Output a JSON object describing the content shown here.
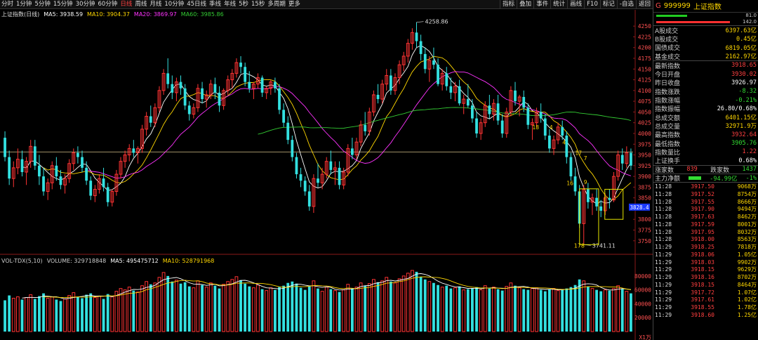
{
  "toolbar": {
    "periods": [
      "分时",
      "1分钟",
      "5分钟",
      "15分钟",
      "30分钟",
      "60分钟",
      "日线",
      "周线",
      "月线",
      "10分钟",
      "45日线",
      "季线",
      "年线",
      "5秒",
      "15秒",
      "多周期",
      "更多"
    ],
    "active_period": "日线",
    "buttons": [
      "指标",
      "叠加",
      "事件",
      "统计",
      "画线",
      "F10",
      "标记",
      "-自选",
      "返回"
    ]
  },
  "chart_title": "上证指数(日线)",
  "ma_legend": [
    {
      "label": "MA5: 3938.59",
      "color": "#ffffff"
    },
    {
      "label": "MA10: 3904.37",
      "color": "#ffd700"
    },
    {
      "label": "MA20: 3869.97",
      "color": "#ff33ff"
    },
    {
      "label": "MA60: 3985.86",
      "color": "#33cc33"
    }
  ],
  "vol_legend": [
    {
      "label": "VOL-TDX(5,10)",
      "color": "#cccccc"
    },
    {
      "label": "VOLUME: 329718848",
      "color": "#cccccc"
    },
    {
      "label": "MA5: 495475712",
      "color": "#ffffff"
    },
    {
      "label": "MA10: 528791968",
      "color": "#ffd700"
    }
  ],
  "price_axis": [
    "4250",
    "4225",
    "4200",
    "4175",
    "4150",
    "4125",
    "4100",
    "4075",
    "4050",
    "4025",
    "4000",
    "3975",
    "3950",
    "3925",
    "3900",
    "3875",
    "3850",
    "3828.4",
    "3800",
    "3775",
    "3750"
  ],
  "current_price_tag": "3828.4",
  "volume_axis": [
    "80000",
    "60000",
    "40000",
    "20000",
    "X1万"
  ],
  "annotations": {
    "high": "4258.86",
    "low": "3741.11",
    "low_left": "178",
    "marks": [
      "18",
      "4",
      "4",
      "17",
      "7",
      "16",
      "9"
    ]
  },
  "chart_data": {
    "type": "candlestick",
    "price_range": [
      3730,
      4265
    ],
    "reference_line": 3957,
    "volume_range": [
      0,
      95000
    ],
    "ohlc": [
      [
        3990,
        4005,
        3935,
        3945
      ],
      [
        3945,
        3960,
        3880,
        3895
      ],
      [
        3895,
        3935,
        3875,
        3920
      ],
      [
        3920,
        3965,
        3905,
        3940
      ],
      [
        3940,
        3960,
        3900,
        3910
      ],
      [
        3910,
        3945,
        3880,
        3935
      ],
      [
        3935,
        3985,
        3920,
        3970
      ],
      [
        3970,
        3985,
        3915,
        3925
      ],
      [
        3925,
        3950,
        3880,
        3900
      ],
      [
        3900,
        3920,
        3855,
        3865
      ],
      [
        3865,
        3895,
        3845,
        3885
      ],
      [
        3885,
        3935,
        3870,
        3925
      ],
      [
        3925,
        3945,
        3890,
        3900
      ],
      [
        3900,
        3915,
        3870,
        3880
      ],
      [
        3880,
        3905,
        3860,
        3895
      ],
      [
        3895,
        3940,
        3885,
        3930
      ],
      [
        3930,
        3965,
        3915,
        3955
      ],
      [
        3955,
        3970,
        3930,
        3945
      ],
      [
        3945,
        3960,
        3910,
        3920
      ],
      [
        3920,
        3935,
        3880,
        3890
      ],
      [
        3890,
        3900,
        3845,
        3855
      ],
      [
        3855,
        3880,
        3840,
        3870
      ],
      [
        3870,
        3905,
        3860,
        3895
      ],
      [
        3895,
        3920,
        3865,
        3875
      ],
      [
        3875,
        3885,
        3830,
        3840
      ],
      [
        3840,
        3870,
        3830,
        3865
      ],
      [
        3865,
        3915,
        3855,
        3905
      ],
      [
        3905,
        3945,
        3895,
        3935
      ],
      [
        3935,
        3960,
        3920,
        3950
      ],
      [
        3950,
        3975,
        3935,
        3965
      ],
      [
        3965,
        3985,
        3945,
        3955
      ],
      [
        3955,
        3970,
        3930,
        3965
      ],
      [
        3965,
        4020,
        3955,
        4010
      ],
      [
        4010,
        4050,
        3995,
        4040
      ],
      [
        4040,
        4065,
        4015,
        4025
      ],
      [
        4025,
        4070,
        4015,
        4060
      ],
      [
        4060,
        4110,
        4050,
        4100
      ],
      [
        4100,
        4150,
        4090,
        4140
      ],
      [
        4140,
        4175,
        4105,
        4115
      ],
      [
        4115,
        4135,
        4080,
        4095
      ],
      [
        4095,
        4130,
        4075,
        4120
      ],
      [
        4120,
        4135,
        4090,
        4105
      ],
      [
        4105,
        4115,
        4055,
        4065
      ],
      [
        4065,
        4075,
        4030,
        4045
      ],
      [
        4045,
        4070,
        4035,
        4060
      ],
      [
        4060,
        4115,
        4050,
        4105
      ],
      [
        4105,
        4120,
        4070,
        4080
      ],
      [
        4080,
        4100,
        4060,
        4090
      ],
      [
        4090,
        4125,
        4080,
        4115
      ],
      [
        4115,
        4130,
        4080,
        4095
      ],
      [
        4095,
        4110,
        4050,
        4065
      ],
      [
        4065,
        4105,
        4055,
        4100
      ],
      [
        4100,
        4135,
        4090,
        4125
      ],
      [
        4125,
        4150,
        4105,
        4140
      ],
      [
        4140,
        4175,
        4130,
        4165
      ],
      [
        4165,
        4180,
        4140,
        4155
      ],
      [
        4155,
        4165,
        4110,
        4120
      ],
      [
        4120,
        4145,
        4095,
        4105
      ],
      [
        4105,
        4120,
        4080,
        4115
      ],
      [
        4115,
        4140,
        4105,
        4130
      ],
      [
        4130,
        4135,
        4085,
        4095
      ],
      [
        4095,
        4110,
        4080,
        4105
      ],
      [
        4105,
        4125,
        4090,
        4120
      ],
      [
        4120,
        4130,
        4095,
        4105
      ],
      [
        4105,
        4115,
        4045,
        4055
      ],
      [
        4055,
        4070,
        4015,
        4025
      ],
      [
        4025,
        4040,
        3975,
        3985
      ],
      [
        3985,
        3995,
        3935,
        3945
      ],
      [
        3945,
        3955,
        3895,
        3905
      ],
      [
        3905,
        3920,
        3875,
        3890
      ],
      [
        3890,
        3900,
        3855,
        3865
      ],
      [
        3865,
        3880,
        3820,
        3830
      ],
      [
        3830,
        3905,
        3815,
        3895
      ],
      [
        3895,
        3930,
        3875,
        3885
      ],
      [
        3885,
        3920,
        3870,
        3905
      ],
      [
        3905,
        3945,
        3895,
        3935
      ],
      [
        3935,
        3960,
        3905,
        3915
      ],
      [
        3915,
        3935,
        3880,
        3920
      ],
      [
        3920,
        3935,
        3870,
        3880
      ],
      [
        3880,
        3920,
        3870,
        3910
      ],
      [
        3910,
        3975,
        3900,
        3965
      ],
      [
        3965,
        3990,
        3940,
        3950
      ],
      [
        3950,
        3990,
        3940,
        3980
      ],
      [
        3980,
        4030,
        3970,
        4020
      ],
      [
        4020,
        4050,
        3995,
        4005
      ],
      [
        4005,
        4060,
        3995,
        4050
      ],
      [
        4050,
        4100,
        4040,
        4090
      ],
      [
        4090,
        4115,
        4070,
        4080
      ],
      [
        4080,
        4125,
        4070,
        4115
      ],
      [
        4115,
        4150,
        4100,
        4135
      ],
      [
        4135,
        4150,
        4090,
        4100
      ],
      [
        4100,
        4140,
        4090,
        4130
      ],
      [
        4130,
        4170,
        4115,
        4160
      ],
      [
        4160,
        4190,
        4145,
        4180
      ],
      [
        4180,
        4220,
        4165,
        4210
      ],
      [
        4210,
        4245,
        4195,
        4235
      ],
      [
        4235,
        4259,
        4200,
        4215
      ],
      [
        4215,
        4230,
        4170,
        4185
      ],
      [
        4185,
        4200,
        4140,
        4150
      ],
      [
        4150,
        4180,
        4120,
        4170
      ],
      [
        4170,
        4200,
        4150,
        4160
      ],
      [
        4160,
        4175,
        4110,
        4115
      ],
      [
        4115,
        4150,
        4100,
        4140
      ],
      [
        4140,
        4155,
        4100,
        4110
      ],
      [
        4110,
        4130,
        4080,
        4095
      ],
      [
        4095,
        4120,
        4075,
        4110
      ],
      [
        4110,
        4125,
        4065,
        4070
      ],
      [
        4070,
        4090,
        4045,
        4080
      ],
      [
        4080,
        4115,
        4060,
        4065
      ],
      [
        4065,
        4080,
        4025,
        4035
      ],
      [
        4035,
        4050,
        3990,
        4000
      ],
      [
        4000,
        4035,
        3985,
        4025
      ],
      [
        4025,
        4075,
        4015,
        4065
      ],
      [
        4065,
        4090,
        4035,
        4045
      ],
      [
        4045,
        4080,
        4030,
        4070
      ],
      [
        4070,
        4090,
        4020,
        4030
      ],
      [
        4030,
        4045,
        3990,
        4000
      ],
      [
        4000,
        4060,
        3990,
        4050
      ],
      [
        4050,
        4110,
        4040,
        4100
      ],
      [
        4100,
        4120,
        4065,
        4075
      ],
      [
        4075,
        4090,
        4040,
        4085
      ],
      [
        4085,
        4100,
        4050,
        4060
      ],
      [
        4060,
        4070,
        4010,
        4020
      ],
      [
        4020,
        4035,
        3985,
        4025
      ],
      [
        4025,
        4060,
        4015,
        4050
      ],
      [
        4050,
        4070,
        4025,
        4035
      ],
      [
        4035,
        4045,
        3985,
        3995
      ],
      [
        3995,
        4010,
        3955,
        3965
      ],
      [
        3965,
        3995,
        3950,
        3985
      ],
      [
        3985,
        4025,
        3975,
        4015
      ],
      [
        4015,
        4030,
        3985,
        3995
      ],
      [
        3995,
        4005,
        3930,
        3945
      ],
      [
        3945,
        3955,
        3890,
        3900
      ],
      [
        3900,
        3920,
        3855,
        3865
      ],
      [
        3865,
        3880,
        3780,
        3790
      ],
      [
        3790,
        3880,
        3741,
        3870
      ],
      [
        3870,
        3885,
        3825,
        3840
      ],
      [
        3840,
        3860,
        3810,
        3850
      ],
      [
        3850,
        3870,
        3820,
        3830
      ],
      [
        3830,
        3845,
        3805,
        3820
      ],
      [
        3820,
        3860,
        3810,
        3850
      ],
      [
        3850,
        3870,
        3825,
        3845
      ],
      [
        3845,
        3910,
        3840,
        3900
      ],
      [
        3900,
        3960,
        3890,
        3950
      ],
      [
        3950,
        3965,
        3915,
        3930
      ],
      [
        3930,
        3970,
        3920,
        3955
      ],
      [
        3955,
        3965,
        3915,
        3925
      ]
    ],
    "volume": [
      45000,
      52000,
      48000,
      50000,
      46000,
      49000,
      53000,
      47000,
      51000,
      55000,
      48000,
      50000,
      46000,
      44000,
      47000,
      52000,
      56000,
      50000,
      48000,
      53000,
      55000,
      49000,
      51000,
      47000,
      54000,
      50000,
      58000,
      62000,
      60000,
      64000,
      59000,
      57000,
      66000,
      72000,
      68000,
      70000,
      78000,
      85000,
      80000,
      72000,
      74000,
      69000,
      71000,
      65000,
      63000,
      73000,
      67000,
      64000,
      70000,
      66000,
      62000,
      68000,
      72000,
      75000,
      79000,
      74000,
      69000,
      65000,
      63000,
      67000,
      61000,
      59000,
      63000,
      60000,
      64000,
      66000,
      70000,
      72000,
      69000,
      63000,
      60000,
      65000,
      73000,
      62000,
      58000,
      64000,
      61000,
      59000,
      57000,
      60000,
      68000,
      62000,
      64000,
      70000,
      66000,
      69000,
      75000,
      71000,
      73000,
      78000,
      72000,
      70000,
      76000,
      80000,
      84000,
      88000,
      86000,
      79000,
      75000,
      72000,
      70000,
      67000,
      64000,
      66000,
      62000,
      63000,
      65000,
      60000,
      61000,
      62000,
      64000,
      60000,
      66000,
      62000,
      64000,
      61000,
      59000,
      65000,
      70000,
      66000,
      63000,
      61000,
      60000,
      62000,
      63000,
      60000,
      58000,
      61000,
      62000,
      59000,
      60000,
      62000,
      64000,
      67000,
      75000,
      73000,
      65000,
      62000,
      60000,
      58000,
      60000,
      59000,
      62000,
      66000,
      61000,
      58000,
      55000
    ]
  },
  "right_panel": {
    "code_prefix": "G",
    "code": "999999",
    "name": "上证指数",
    "bars": [
      {
        "value": "81.0",
        "red": 0.35,
        "green": 0.4
      },
      {
        "value": "142.0",
        "red": 0.95,
        "green": 0
      }
    ],
    "stats_a": [
      {
        "label": "A股成交",
        "value": "6397.63亿",
        "color": "#ffd700"
      },
      {
        "label": "B股成交",
        "value": "0.45亿",
        "color": "#ffd700"
      },
      {
        "label": "国债成交",
        "value": "6819.05亿",
        "color": "#ffd700"
      },
      {
        "label": "基金成交",
        "value": "2162.97亿",
        "color": "#ffd700"
      }
    ],
    "stats_b": [
      {
        "label": "最新指数",
        "value": "3918.65",
        "color": "#ff4040"
      },
      {
        "label": "今日开盘",
        "value": "3930.02",
        "color": "#ff4040"
      },
      {
        "label": "昨日收盘",
        "value": "3926.97",
        "color": "#ffffff"
      },
      {
        "label": "指数涨跌",
        "value": "-8.32",
        "color": "#33dd33"
      },
      {
        "label": "指数涨幅",
        "value": "-0.21%",
        "color": "#33dd33"
      },
      {
        "label": "指数振幅",
        "value": "26.80/0.68%",
        "color": "#ffffff"
      },
      {
        "label": "总成交额",
        "value": "6401.15亿",
        "color": "#ffd700"
      },
      {
        "label": "总成交量",
        "value": "32971.9万",
        "color": "#ffd700"
      },
      {
        "label": "最高指数",
        "value": "3932.64",
        "color": "#ff4040"
      },
      {
        "label": "最低指数",
        "value": "3905.76",
        "color": "#33dd33"
      },
      {
        "label": "指数量比",
        "value": "1.22",
        "color": "#ff4040"
      },
      {
        "label": "上证换手",
        "value": "0.68%",
        "color": "#ffffff"
      }
    ],
    "breadth": {
      "up_label": "涨家数",
      "up": "839",
      "down_label": "跌家数",
      "down": "1437"
    },
    "net_flow": {
      "label": "主力净额",
      "value": "-94.99亿",
      "pct": "-1%"
    },
    "ticks": [
      {
        "time": "11:28",
        "price": "3917.50",
        "vol": "9068万"
      },
      {
        "time": "11:28",
        "price": "3917.52",
        "vol": "8754万"
      },
      {
        "time": "11:28",
        "price": "3917.55",
        "vol": "8666万"
      },
      {
        "time": "11:28",
        "price": "3917.90",
        "vol": "9494万"
      },
      {
        "time": "11:28",
        "price": "3917.63",
        "vol": "8462万"
      },
      {
        "time": "11:28",
        "price": "3917.59",
        "vol": "8001万"
      },
      {
        "time": "11:28",
        "price": "3917.95",
        "vol": "8032万"
      },
      {
        "time": "11:28",
        "price": "3918.00",
        "vol": "8563万"
      },
      {
        "time": "11:29",
        "price": "3918.25",
        "vol": "7818万"
      },
      {
        "time": "11:29",
        "price": "3918.06",
        "vol": "1.05亿"
      },
      {
        "time": "11:29",
        "price": "3918.03",
        "vol": "9902万"
      },
      {
        "time": "11:29",
        "price": "3918.15",
        "vol": "9629万"
      },
      {
        "time": "11:29",
        "price": "3918.16",
        "vol": "8702万"
      },
      {
        "time": "11:29",
        "price": "3918.15",
        "vol": "8464万"
      },
      {
        "time": "11:29",
        "price": "3917.72",
        "vol": "1.07亿"
      },
      {
        "time": "11:29",
        "price": "3917.61",
        "vol": "1.02亿"
      },
      {
        "time": "11:29",
        "price": "3918.55",
        "vol": "1.78亿"
      },
      {
        "time": "11:29",
        "price": "3918.60",
        "vol": "1.25亿"
      }
    ]
  }
}
